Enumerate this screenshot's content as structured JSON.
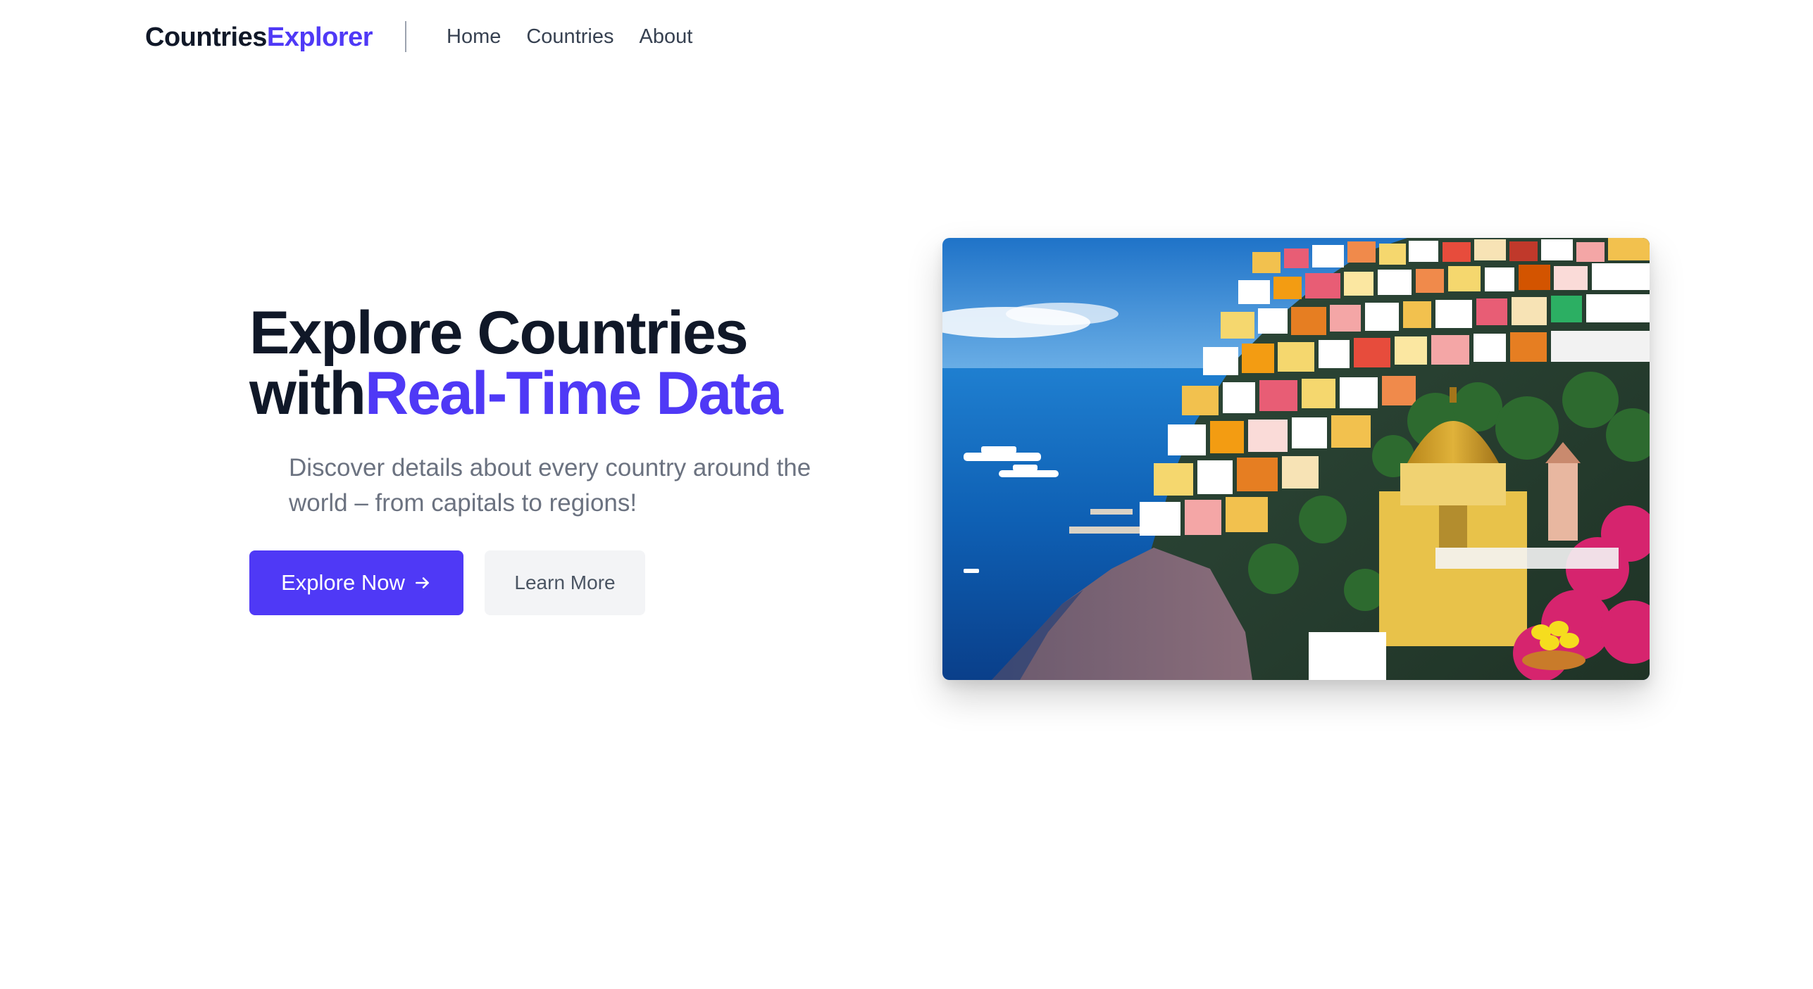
{
  "brand": {
    "part1": "Countries",
    "part2": "Explorer"
  },
  "nav": {
    "items": [
      {
        "label": "Home"
      },
      {
        "label": "Countries"
      },
      {
        "label": "About"
      }
    ]
  },
  "hero": {
    "title_line1": "Explore Countries",
    "title_line2_prefix": "with",
    "title_line2_accent": "Real-Time Data",
    "subtitle": "Discover details about every country around the world – from capitals to regions!",
    "primary_button": "Explore Now",
    "primary_button_icon": "arrow-right-icon",
    "secondary_button": "Learn More",
    "image_icon": "coastal-town-photo"
  },
  "colors": {
    "accent": "#4f39f6",
    "heading": "#101828",
    "muted": "#6b7280",
    "secondary_bg": "#f3f4f6"
  }
}
